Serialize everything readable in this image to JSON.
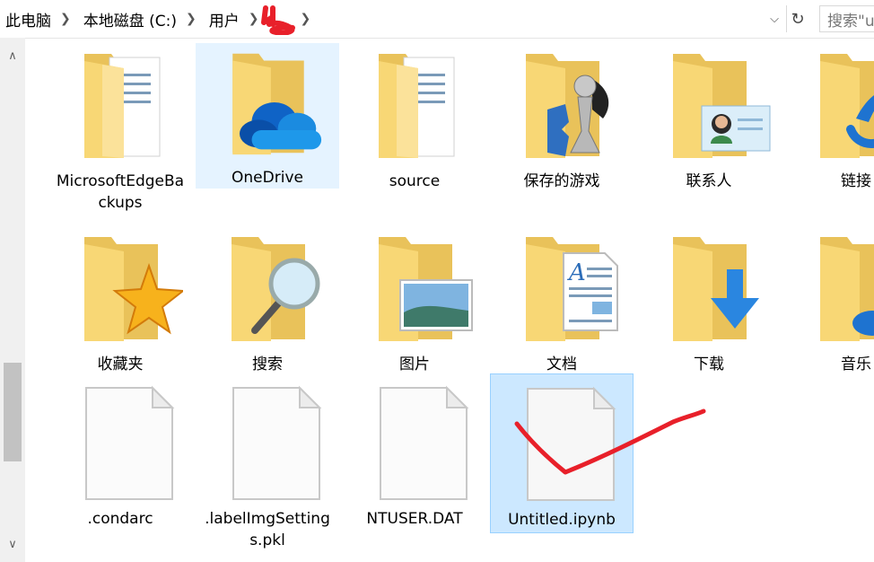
{
  "address_bar": {
    "breadcrumbs": [
      "此电脑",
      "本地磁盘 (C:)",
      "用户"
    ],
    "search_placeholder": "搜索\"u"
  },
  "icons": {
    "dropdown": "chevron-down-icon",
    "refresh": "refresh-icon",
    "scroll_up": "chevron-up-icon",
    "scroll_down": "chevron-down-icon"
  },
  "colors": {
    "selection_bg": "#cce8ff",
    "hover_bg": "#e5f3ff",
    "folder": "#f8d775",
    "annotation_red": "#e8202a"
  },
  "items": [
    {
      "label": "MicrosoftEdgeBackups",
      "icon": "folder-documents-icon"
    },
    {
      "label": "OneDrive",
      "icon": "folder-onedrive-icon"
    },
    {
      "label": "source",
      "icon": "folder-documents-icon"
    },
    {
      "label": "保存的游戏",
      "icon": "folder-games-icon"
    },
    {
      "label": "联系人",
      "icon": "folder-contacts-icon"
    },
    {
      "label": "链接",
      "icon": "folder-links-icon"
    },
    {
      "label": "收藏夹",
      "icon": "folder-favorites-icon"
    },
    {
      "label": "搜索",
      "icon": "folder-search-icon"
    },
    {
      "label": "图片",
      "icon": "folder-pictures-icon"
    },
    {
      "label": "文档",
      "icon": "folder-docs-icon"
    },
    {
      "label": "下载",
      "icon": "folder-downloads-icon"
    },
    {
      "label": "音乐",
      "icon": "folder-music-icon"
    },
    {
      "label": ".condarc",
      "icon": "file-icon"
    },
    {
      "label": ".labelImgSettings.pkl",
      "icon": "file-icon"
    },
    {
      "label": "NTUSER.DAT",
      "icon": "file-icon"
    },
    {
      "label": "Untitled.ipynb",
      "icon": "file-icon"
    }
  ]
}
